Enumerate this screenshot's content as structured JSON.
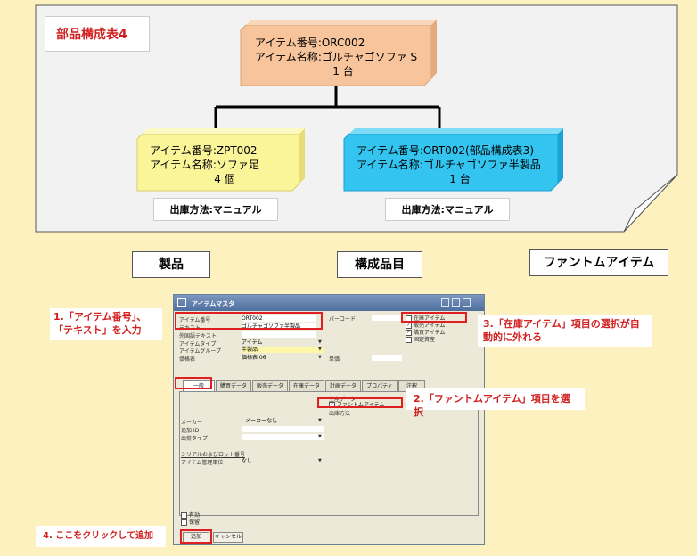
{
  "diagram": {
    "title": "部品構成表4",
    "top_node": {
      "number_label": "アイテム番号",
      "number": "ORC002",
      "name_label": "アイテム名称",
      "name": "ゴルチャゴソファ S",
      "qty": "1 台"
    },
    "left_node": {
      "number_label": "アイテム番号",
      "number": "ZPT002",
      "name_label": "アイテム名称",
      "name": "ソファ足",
      "qty": "4 個"
    },
    "right_node": {
      "number_label": "アイテム番号",
      "number": "ORT002(部品構成表3)",
      "name_label": "アイテム名称",
      "name": "ゴルチャゴソファ半製品",
      "qty": "1 台"
    },
    "left_ship": "出庫方法:マニュアル",
    "right_ship": "出庫方法:マニュアル"
  },
  "legend": [
    {
      "label": "製品",
      "color": "#f7c49b"
    },
    {
      "label": "構成品目",
      "color": "#fbf59a"
    },
    {
      "label": "ファントムアイテム",
      "color": "#33c4f0"
    }
  ],
  "window": {
    "title": "アイテムマスタ",
    "fields": {
      "item_no_label": "アイテム番号",
      "item_no": "ORT002",
      "text_label": "テキスト",
      "text": "ゴルチャゴソファ半製品",
      "foreign_label": "外国語テキスト",
      "type_label": "アイテムタイプ",
      "type": "アイテム",
      "group_label": "アイテムグループ",
      "group": "半製品",
      "price_label": "価格表",
      "price": "価格表 06",
      "barcode_label": "バーコード",
      "unit_price_label": "単価"
    },
    "checks": {
      "stock": "在庫アイテム",
      "sales": "販売アイテム",
      "purchase": "購買アイテム",
      "fixed": "固定資産"
    },
    "tabs": [
      "一般",
      "購買データ",
      "販売データ",
      "在庫データ",
      "計画データ",
      "プロパティ",
      "注釈"
    ],
    "general": {
      "production_data": "生産データ",
      "phantom": "ファントムアイテム",
      "issue_method": "出庫方法",
      "maker_label": "メーカー",
      "maker": "- メーカーなし -",
      "add_id_label": "追加 ID",
      "ship_type_label": "出荷タイプ",
      "serial_label": "シリアルおよびロット番号",
      "mgmt_label": "アイテム管理単位",
      "mgmt": "なし",
      "active": "有効",
      "hold": "保留"
    },
    "buttons": {
      "add": "追加",
      "cancel": "キャンセル"
    }
  },
  "callouts": {
    "c1": "1.「アイテム番号」、「テキスト」を入力",
    "c2": "2.「ファントムアイテム」項目を選択",
    "c3": "3.「在庫アイテム」項目の選択が自動的に外れる",
    "c4": "4. ここをクリックして追加"
  }
}
